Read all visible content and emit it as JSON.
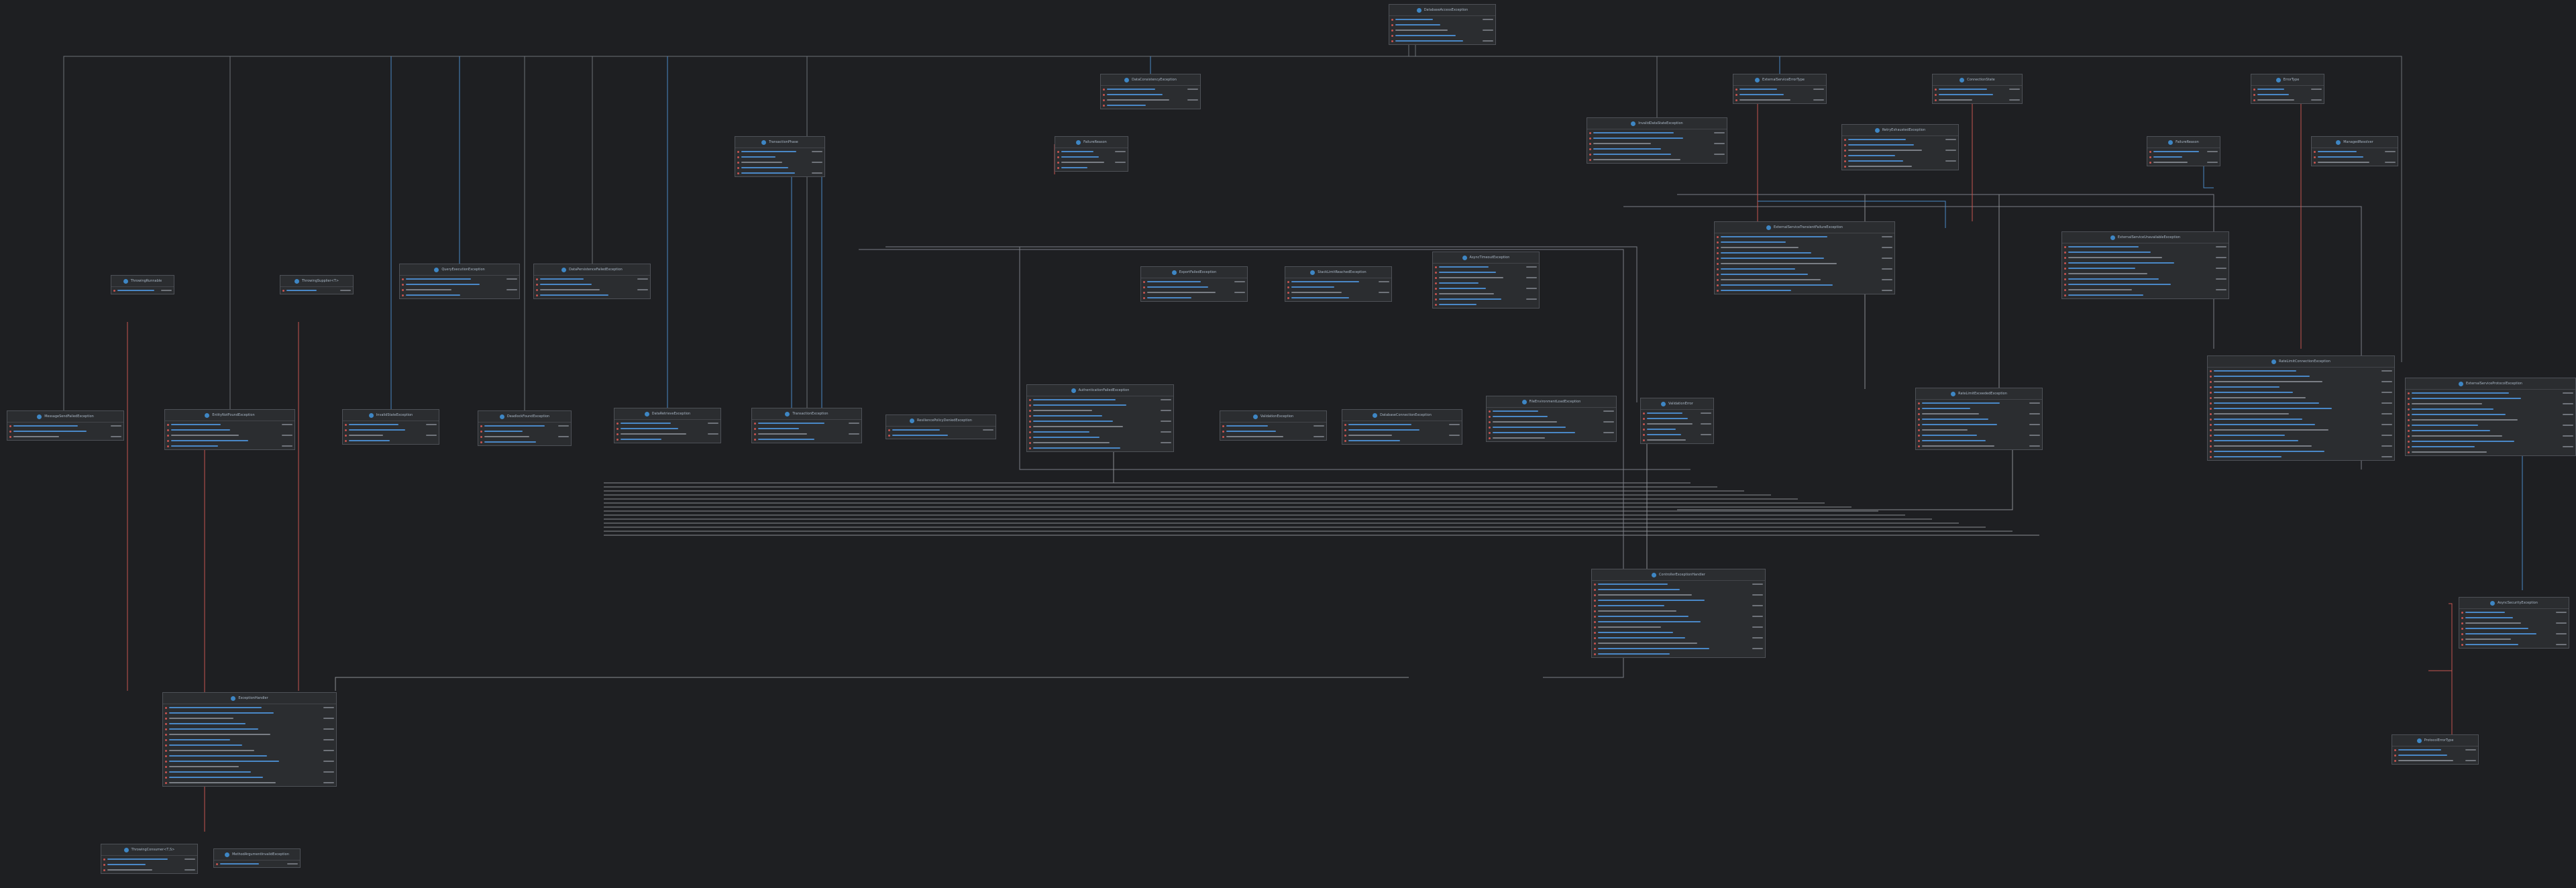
{
  "colors": {
    "background": "#1e1f22",
    "card": "#2b2d30",
    "border": "#4e5157",
    "blue_link": "#4a88c7",
    "red_link": "#c75450",
    "gray_link": "#8a8d93"
  },
  "nodes": [
    {
      "id": "n0",
      "title": "DatabaseAccessException",
      "rows": 5
    },
    {
      "id": "n1",
      "title": "DataConsistencyException",
      "rows": 4
    },
    {
      "id": "n2",
      "title": "TransactionPhase",
      "rows": 5
    },
    {
      "id": "n3",
      "title": "FailureReason",
      "rows": 4
    },
    {
      "id": "n4",
      "title": "InvalidDataStateException",
      "rows": 6
    },
    {
      "id": "n5",
      "title": "ExternalServiceErrorType",
      "rows": 3
    },
    {
      "id": "n6",
      "title": "ConnectionState",
      "rows": 3
    },
    {
      "id": "n7",
      "title": "ErrorType",
      "rows": 3
    },
    {
      "id": "n8",
      "title": "RetryExhaustedException",
      "rows": 6
    },
    {
      "id": "n9",
      "title": "FailureReason",
      "rows": 3
    },
    {
      "id": "n10",
      "title": "ManagedResolver",
      "rows": 3
    },
    {
      "id": "n11",
      "title": "ThrowingRunnable",
      "rows": 1
    },
    {
      "id": "n12",
      "title": "ThrowingSupplier<T>",
      "rows": 1
    },
    {
      "id": "n13",
      "title": "QueryExecutionException",
      "rows": 4
    },
    {
      "id": "n14",
      "title": "DataPersistenceFailedException",
      "rows": 4
    },
    {
      "id": "n15",
      "title": "ExportFailedException",
      "rows": 4
    },
    {
      "id": "n16",
      "title": "StackLimitReachedException",
      "rows": 4
    },
    {
      "id": "n17",
      "title": "AsyncTimeoutException",
      "rows": 8
    },
    {
      "id": "n18",
      "title": "ExternalServiceTransientFailureException",
      "rows": 11
    },
    {
      "id": "n19",
      "title": "ExternalServiceUnavailableException",
      "rows": 10
    },
    {
      "id": "n20",
      "title": "MessageSendFailedException",
      "rows": 3
    },
    {
      "id": "n21",
      "title": "EntityNotFoundException",
      "rows": 5
    },
    {
      "id": "n22",
      "title": "InvalidStateException",
      "rows": 4
    },
    {
      "id": "n23",
      "title": "DeadlockFoundException",
      "rows": 4
    },
    {
      "id": "n24",
      "title": "DataRetrieveException",
      "rows": 4
    },
    {
      "id": "n25",
      "title": "TransactionException",
      "rows": 4
    },
    {
      "id": "n26",
      "title": "ResiliencePolicyDeniedException",
      "rows": 2
    },
    {
      "id": "n27",
      "title": "AuthenticationFailedException",
      "rows": 10
    },
    {
      "id": "n28",
      "title": "ValidationException",
      "rows": 3
    },
    {
      "id": "n29",
      "title": "DatabaseConnectionException",
      "rows": 4
    },
    {
      "id": "n30",
      "title": "FileEnvironmentLoadException",
      "rows": 6
    },
    {
      "id": "n31",
      "title": "ValidationError",
      "rows": 6
    },
    {
      "id": "n32",
      "title": "RateLimitExceededException",
      "rows": 9
    },
    {
      "id": "n33",
      "title": "RateLimitConnectionException",
      "rows": 17
    },
    {
      "id": "n34",
      "title": "ExternalServiceProtocolException",
      "rows": 12
    },
    {
      "id": "n35",
      "title": "ControllerExceptionHandler",
      "rows": 14
    },
    {
      "id": "n36",
      "title": "ExceptionHandler",
      "rows": 15
    },
    {
      "id": "n37",
      "title": "AsyncSecurityException",
      "rows": 7
    },
    {
      "id": "n38",
      "title": "ProtocolErrorType",
      "rows": 3
    },
    {
      "id": "n39",
      "title": "ThrowingConsumer<T,S>",
      "rows": 3
    },
    {
      "id": "n40",
      "title": "MethodArgumentInvalidException",
      "rows": 1
    }
  ]
}
